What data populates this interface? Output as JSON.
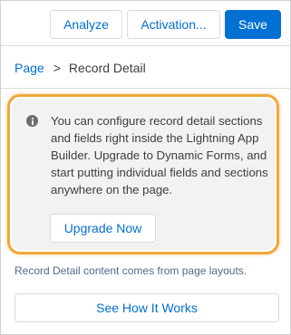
{
  "toolbar": {
    "analyze_label": "Analyze",
    "activation_label": "Activation...",
    "save_label": "Save"
  },
  "breadcrumb": {
    "parent": "Page",
    "separator": ">",
    "current": "Record Detail"
  },
  "info_card": {
    "icon": "info-icon",
    "message": "You can configure record detail sections and fields right inside the Lightning App Builder. Upgrade to Dynamic Forms, and start putting individual fields and sections anywhere on the page.",
    "upgrade_label": "Upgrade Now",
    "highlight_color": "#f0a73c"
  },
  "note": "Record Detail content comes from page layouts.",
  "see_how_label": "See How It Works",
  "colors": {
    "brand": "#0070d2",
    "card_bg": "#f3f2f2"
  }
}
